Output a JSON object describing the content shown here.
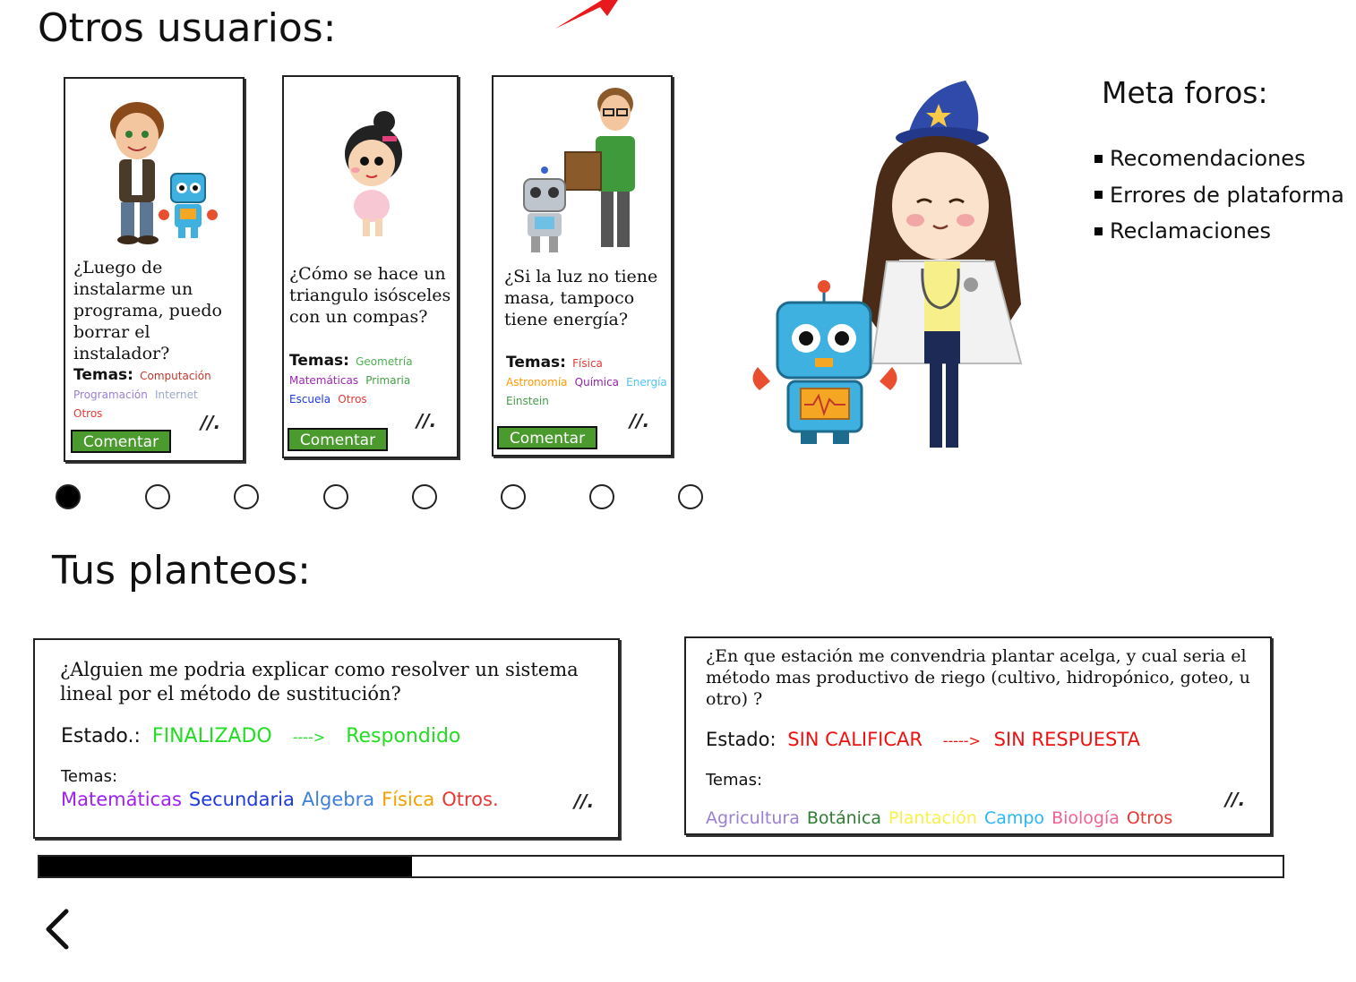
{
  "headings": {
    "otros_usuarios": "Otros usuarios:",
    "tus_planteos": "Tus planteos:",
    "meta_foros": "Meta foros:"
  },
  "meta_foros": [
    "Recomendaciones",
    "Errores de plataforma",
    "Reclamaciones"
  ],
  "other_cards": [
    {
      "question": "¿Luego de instalarme un programa, puedo borrar el instalador?",
      "temas_label": "Temas:",
      "tags": [
        {
          "text": "Computación",
          "color": "#c0392b"
        },
        {
          "text": "Programación",
          "color": "#9b7fd4"
        },
        {
          "text": "Internet",
          "color": "#9aa8c8"
        },
        {
          "text": "Otros",
          "color": "#e53935"
        }
      ],
      "button": "Comentar"
    },
    {
      "question": "¿Cómo se hace un triangulo isósceles con un compas?",
      "temas_label": "Temas:",
      "tags": [
        {
          "text": "Geometría",
          "color": "#4caf50"
        },
        {
          "text": "Matemáticas",
          "color": "#9c27b0"
        },
        {
          "text": "Primaria",
          "color": "#43a047"
        },
        {
          "text": "Escuela",
          "color": "#1e3adb"
        },
        {
          "text": "Otros",
          "color": "#e53935"
        }
      ],
      "button": "Comentar"
    },
    {
      "question": "¿Si la luz no tiene masa, tampoco tiene energía?",
      "temas_label": "Temas:",
      "tags": [
        {
          "text": "Física",
          "color": "#e53935"
        },
        {
          "text": "Astronomía",
          "color": "#ff9800"
        },
        {
          "text": "Química",
          "color": "#8e24aa"
        },
        {
          "text": "Energía",
          "color": "#4fc3f7"
        },
        {
          "text": "Einstein",
          "color": "#43a047"
        }
      ],
      "button": "Comentar"
    }
  ],
  "carousel": {
    "count": 8,
    "active_index": 0
  },
  "planteos": [
    {
      "question": "¿Alguien me podria explicar como resolver un sistema lineal por el método de sustitución?",
      "estado_label": "Estado.:",
      "estado_value": "FINALIZADO",
      "arrow": "---->",
      "result": "Respondido",
      "status_color": "#22dd22",
      "temas_label": "Temas:",
      "tags": [
        {
          "text": "Matemáticas",
          "color": "#a020f0"
        },
        {
          "text": "Secundaria",
          "color": "#1e3adb"
        },
        {
          "text": "Algebra",
          "color": "#3d7fd9"
        },
        {
          "text": "Física",
          "color": "#f4a000"
        },
        {
          "text": "Otros.",
          "color": "#e53935"
        }
      ]
    },
    {
      "question": "¿En que estación me convendria plantar acelga, y cual seria el método mas productivo de riego (cultivo, hidropónico, goteo, u otro) ?",
      "estado_label": "Estado:",
      "estado_value": "SIN CALIFICAR",
      "arrow": "----->",
      "result": "SIN RESPUESTA",
      "status_color": "#ee1111",
      "temas_label": "Temas:",
      "tags": [
        {
          "text": "Agricultura",
          "color": "#9b7fd4"
        },
        {
          "text": "Botánica",
          "color": "#2e7d32"
        },
        {
          "text": "Plantación",
          "color": "#f9f04a"
        },
        {
          "text": "Campo",
          "color": "#29b6f6"
        },
        {
          "text": "Biología",
          "color": "#f06292"
        },
        {
          "text": "Otros",
          "color": "#e53935"
        }
      ]
    }
  ],
  "progress": {
    "fraction": 0.3
  }
}
